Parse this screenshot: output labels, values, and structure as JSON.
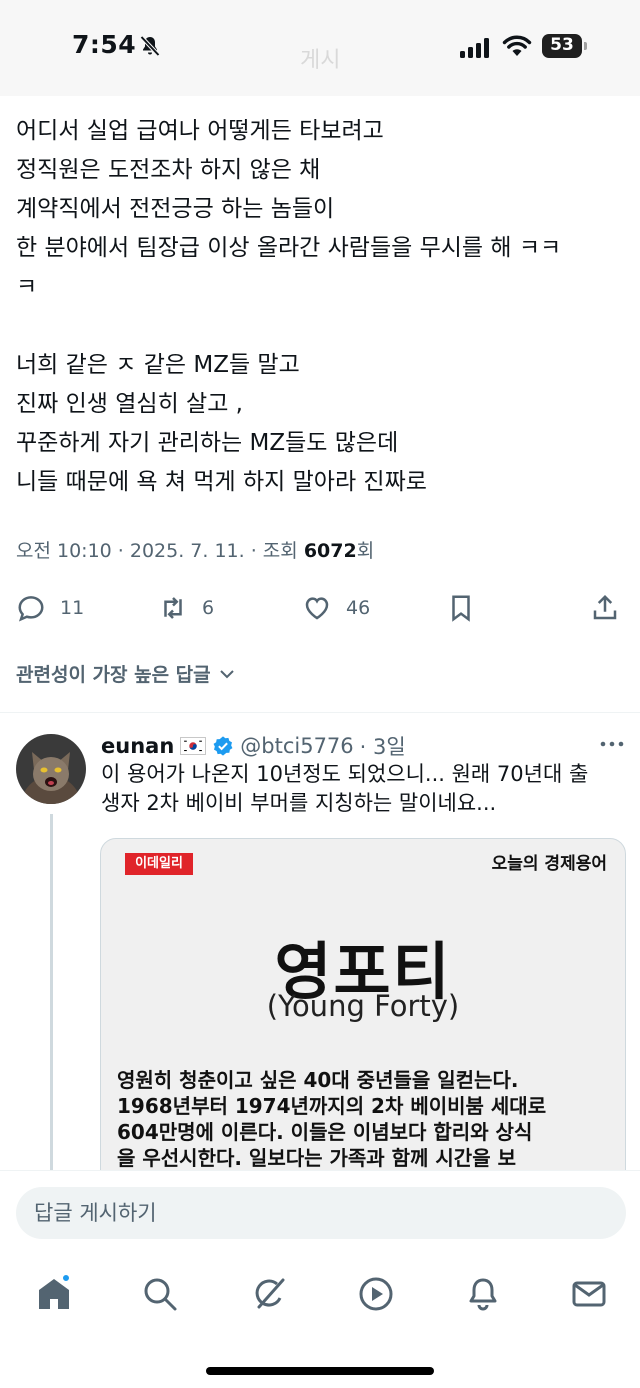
{
  "status_bar": {
    "time": "7:54",
    "battery": "53",
    "faded_title": "게시"
  },
  "tweet": {
    "lines": [
      "어디서 실업 급여나 어떻게든 타보려고",
      "정직원은 도전조차 하지 않은 채",
      "계약직에서 전전긍긍 하는 놈들이",
      "한 분야에서 팀장급 이상 올라간 사람들을 무시를 해 ㅋㅋ",
      "ㅋ",
      "",
      "너희 같은 ㅈ 같은 MZ들 말고",
      "진짜 인생 열심히 살고 ,",
      "꾸준하게 자기 관리하는 MZ들도 많은데",
      "니들 때문에 욕 쳐 먹게 하지 말아라 진짜로"
    ],
    "meta_prefix": "오전 10:10 · 2025. 7. 11. · 조회 ",
    "views": "6072",
    "meta_suffix": "회",
    "reply_count": "11",
    "retweet_count": "6",
    "like_count": "46"
  },
  "sort_label": "관련성이 가장 높은 답글",
  "reply": {
    "name": "eunan",
    "handle": "@btci5776",
    "time": "· 3일",
    "lines": [
      "이 용어가 나온지 10년정도 되었으니... 원래 70년대 출",
      "생자 2차 베이비 부머를 지칭하는 말이네요..."
    ],
    "image": {
      "brand": "이데일리",
      "series": "오늘의 경제용어",
      "term": "영포티",
      "term_en": "(Young Forty)",
      "definition_lines": [
        "영원히 청춘이고 싶은 40대 중년들을 일컫는다.",
        "1968년부터 1974년까지의 2차 베이비붐 세대로",
        "604만명에 이른다. 이들은 이념보다 합리와 상식",
        "을 우선시한다. 일보다는 가족과 함께 시간을 보"
      ]
    }
  },
  "composer": {
    "placeholder": "답글 게시하기"
  },
  "tabs": [
    "home-icon",
    "search-icon",
    "grok-icon",
    "video-icon",
    "notifications-icon",
    "messages-icon"
  ],
  "colors": {
    "accent": "#1d9bf0",
    "secondary_text": "#536471",
    "primary_text": "#0f1419"
  }
}
